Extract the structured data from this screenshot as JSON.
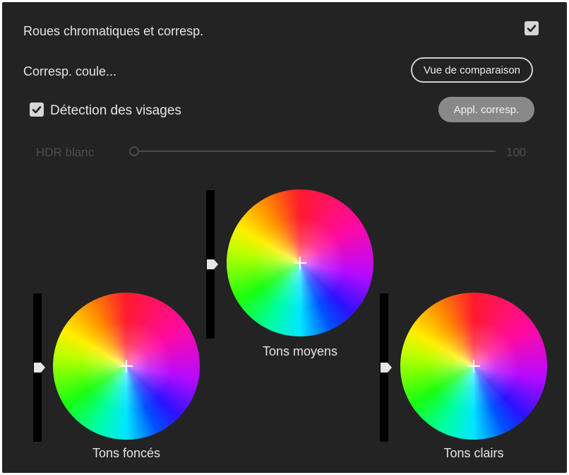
{
  "header": {
    "title": "Roues chromatiques et corresp.",
    "enabled": true
  },
  "color_match": {
    "section_label": "Corresp. coule...",
    "comparison_button": "Vue de comparaison",
    "face_detection_label": "Détection des visages",
    "face_detection_checked": true,
    "apply_button": "Appl. corresp."
  },
  "hdr_white": {
    "label": "HDR blanc",
    "value": "100",
    "disabled": true
  },
  "wheels": {
    "midtones": {
      "label": "Tons moyens"
    },
    "shadows": {
      "label": "Tons foncés"
    },
    "highlights": {
      "label": "Tons clairs"
    }
  },
  "colors": {
    "panel_background": "#232323",
    "text": "#e4e4e4",
    "disabled_text": "#4e4e4e",
    "apply_button_fill": "#898989"
  }
}
